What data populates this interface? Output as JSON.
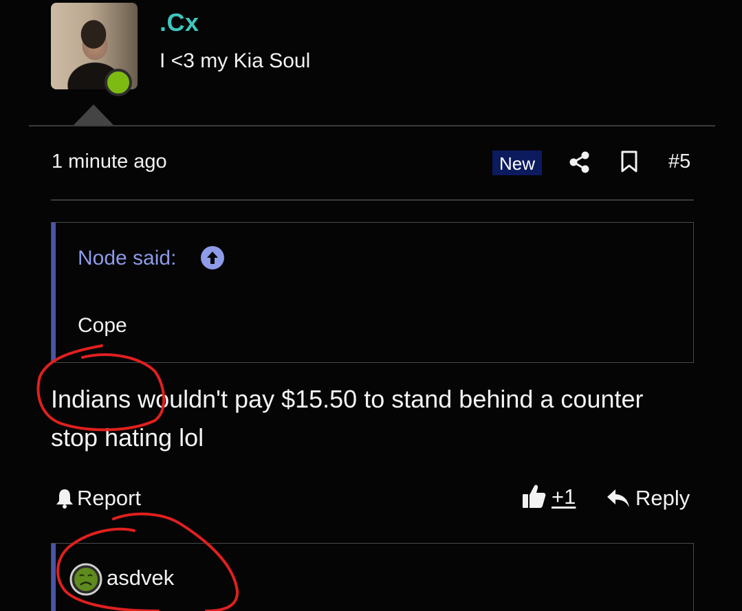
{
  "user": {
    "name": ".Cx",
    "title": "I <3 my Kia Soul",
    "status_color": "#7dbb12"
  },
  "post": {
    "time": "1 minute ago",
    "badge": "New",
    "number": "#5",
    "quote": {
      "author": "Node said:",
      "text": "Cope"
    },
    "body": "Indians wouldn't pay $15.50 to stand behind a counter stop hating lol",
    "actions": {
      "report": "Report",
      "like_count": "+1",
      "reply": "Reply"
    },
    "reactions": {
      "user": "asdvek",
      "emoji": "nauseated-face-icon"
    }
  },
  "colors": {
    "accent_name": "#3ec6bd",
    "quote_author": "#8d9be9",
    "quote_bar": "#4a55a6",
    "badge_bg": "#0c1a5e",
    "annotation": "#e0201f"
  }
}
